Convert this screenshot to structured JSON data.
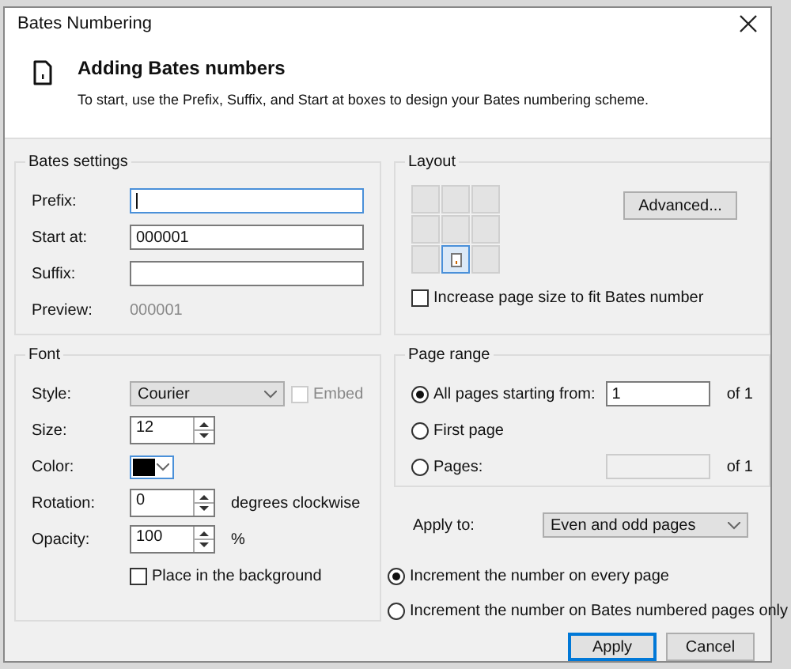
{
  "window": {
    "title": "Bates Numbering"
  },
  "header": {
    "title": "Adding Bates numbers",
    "description": "To start, use the Prefix, Suffix, and Start at boxes to design your Bates numbering scheme."
  },
  "bates_settings": {
    "title": "Bates settings",
    "fields": [
      {
        "label": "Prefix:",
        "focused": true
      },
      {
        "label": "Start at:",
        "value": "000001",
        "focused": false
      },
      {
        "label": "Suffix:",
        "focused": false
      }
    ],
    "preview": {
      "label": "Preview:",
      "value": "000001"
    }
  },
  "font": {
    "title": "Font",
    "style": {
      "label": "Style:",
      "value": "Courier"
    },
    "embed": {
      "label": "Embed",
      "checked": false,
      "disabled": true
    },
    "size": {
      "label": "Size:",
      "value": "12"
    },
    "color": {
      "label": "Color:",
      "color": "#000000"
    },
    "rotation": {
      "label": "Rotation:",
      "value": "0",
      "unit": "degrees clockwise"
    },
    "opacity": {
      "label": "Opacity:",
      "value": "100",
      "unit": "%"
    },
    "background": {
      "label": "Place in the background",
      "checked": false
    }
  },
  "layout": {
    "title": "Layout",
    "positions": [
      {
        "selected": false
      },
      {
        "selected": false
      },
      {
        "selected": false
      },
      {
        "selected": false
      },
      {
        "selected": false
      },
      {
        "selected": false
      },
      {
        "selected": false
      },
      {
        "selected": true
      },
      {
        "selected": false
      }
    ],
    "advanced_button": "Advanced...",
    "increase": {
      "label": "Increase page size to fit Bates number",
      "checked": false
    }
  },
  "page_range": {
    "title": "Page range",
    "options": [
      {
        "label": "All pages starting from:",
        "selected": true,
        "value": "1",
        "suffix": "of 1",
        "kind": "field"
      },
      {
        "label": "First page",
        "selected": false,
        "kind": "plain"
      },
      {
        "label": "Pages:",
        "selected": false,
        "suffix": "of 1",
        "kind": "field"
      }
    ]
  },
  "apply_to": {
    "label": "Apply to:",
    "value": "Even and odd pages"
  },
  "increment_options": [
    {
      "label": "Increment the number on every page",
      "selected": true
    },
    {
      "label": "Increment the number on Bates numbered pages only",
      "selected": false
    }
  ],
  "buttons": [
    {
      "label": "Apply",
      "kind": "primary"
    },
    {
      "label": "Cancel",
      "kind": "normal"
    }
  ]
}
